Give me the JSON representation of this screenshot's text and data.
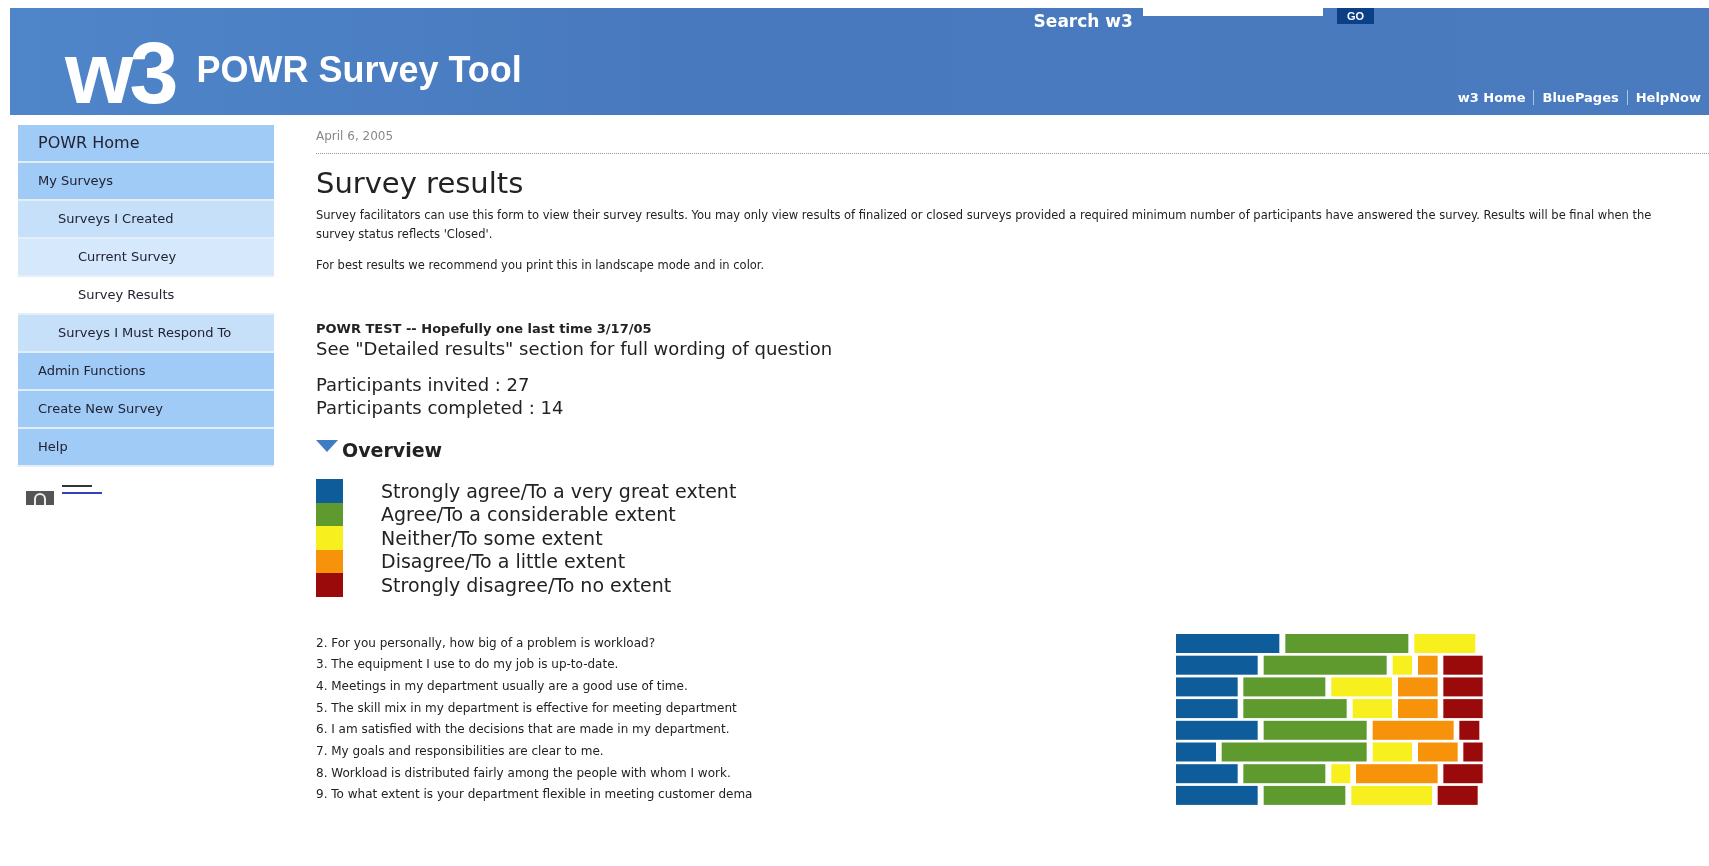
{
  "header": {
    "logo": "w3",
    "title": "POWR Survey Tool",
    "search_label": "Search w3",
    "search_button": "GO",
    "links": [
      "w3 Home",
      "BluePages",
      "HelpNow"
    ]
  },
  "sidebar": {
    "items": [
      {
        "label": "POWR Home",
        "selected": false
      },
      {
        "label": "My Surveys",
        "selected": false,
        "children": [
          {
            "label": "Surveys I Created",
            "selected": false,
            "children": [
              {
                "label": "Current Survey",
                "selected": false
              },
              {
                "label": "Survey Results",
                "selected": true
              }
            ]
          },
          {
            "label": "Surveys I Must Respond To",
            "selected": false
          }
        ]
      },
      {
        "label": "Admin Functions",
        "selected": false
      },
      {
        "label": "Create New Survey",
        "selected": false
      },
      {
        "label": "Help",
        "selected": false
      }
    ]
  },
  "date": "April 6, 2005",
  "heading": "Survey results",
  "intro": [
    "Survey facilitators can use this form to view their survey results. You may only view results of finalized or closed surveys provided a required minimum number of participants have answered the survey. Results will be final when the survey status reflects 'Closed'.",
    "For best results we recommend you print this in landscape mode and in color."
  ],
  "survey_title": "POWR TEST -- Hopefully one last time 3/17/05",
  "note": "See \"Detailed results\" section for full wording of question",
  "participants": [
    "Participants invited : 27",
    "Participants completed : 14"
  ],
  "overview": {
    "title": "Overview",
    "expanded": true
  },
  "legend": [
    {
      "label": "Strongly agree/To a very great extent",
      "color": "#0e5d9a"
    },
    {
      "label": "Agree/To a considerable extent",
      "color": "#5f9a2f"
    },
    {
      "label": "Neither/To some extent",
      "color": "#f7ef1e"
    },
    {
      "label": "Disagree/To a little extent",
      "color": "#f7930a"
    },
    {
      "label": "Strongly disagree/To no extent",
      "color": "#9b0a0a"
    }
  ],
  "questions": [
    "2. For you personally, how big of a problem is workload?",
    "3. The equipment I use to do my job is up-to-date.",
    "4. Meetings in my department usually are a good use of time.",
    "5. The skill mix in my department is effective for meeting department",
    "6. I am satisfied with the decisions that are made in my department.",
    "7. My goals and responsibilities are clear to me.",
    "8. Workload is distributed fairly among the people with whom I work.",
    "9. To what extent is your department flexible in meeting customer dema"
  ]
}
